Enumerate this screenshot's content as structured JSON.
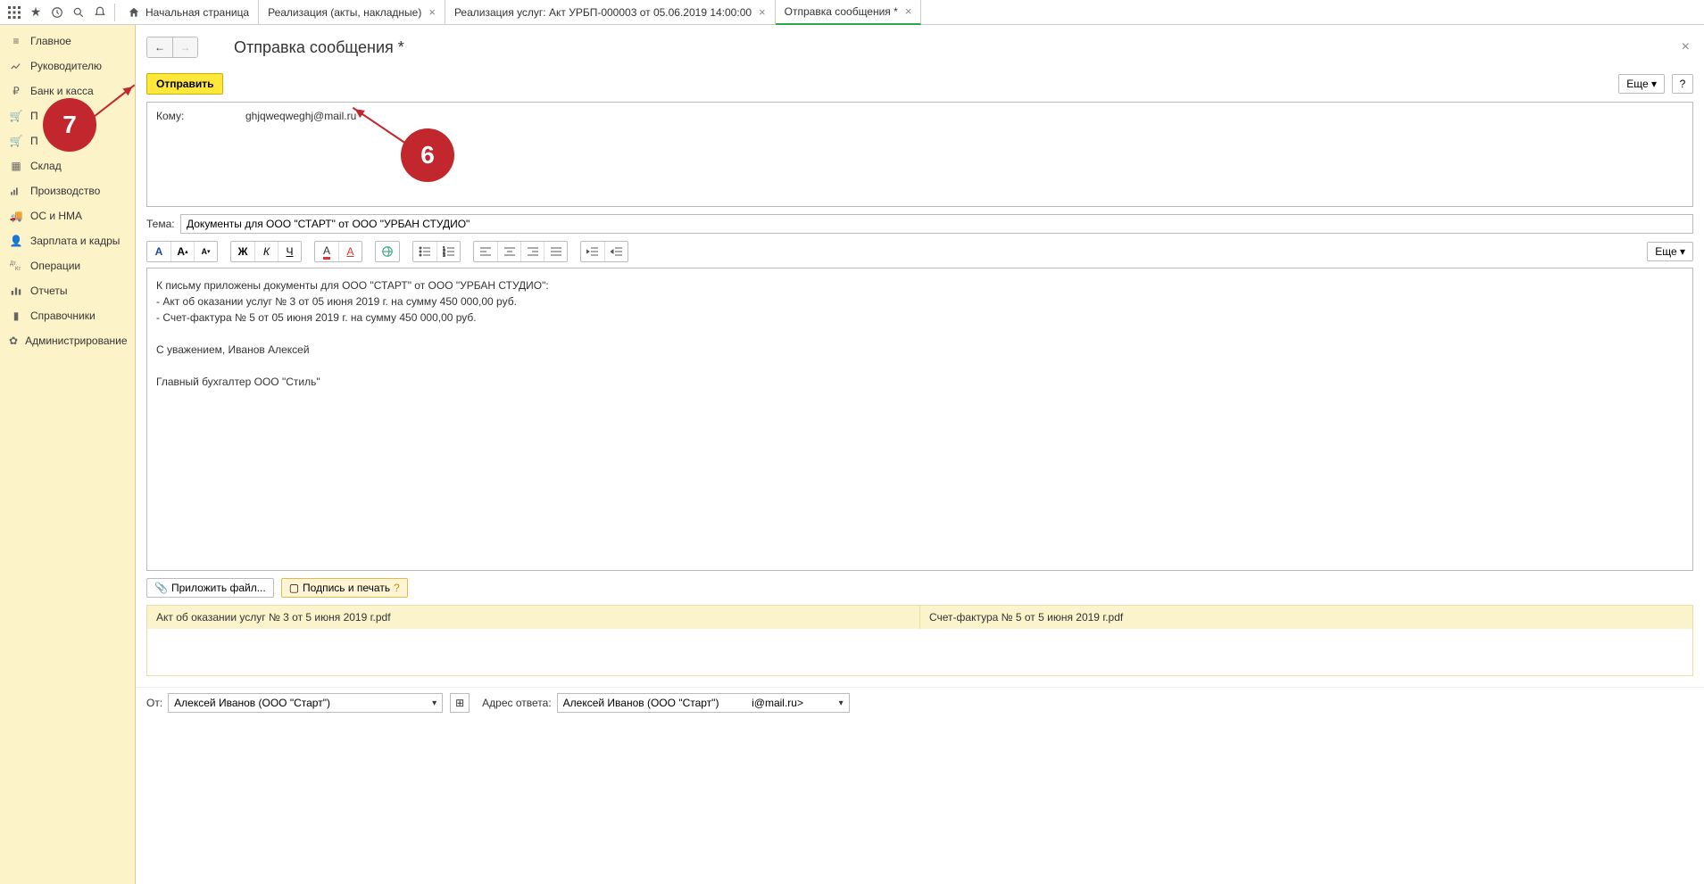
{
  "tabs": {
    "home": "Начальная страница",
    "t1": "Реализация (акты, накладные)",
    "t2": "Реализация услуг: Акт УРБП-000003 от 05.06.2019 14:00:00",
    "t3": "Отправка сообщения *"
  },
  "sidebar": {
    "items": [
      "Главное",
      "Руководителю",
      "Банк и касса",
      "П",
      "П",
      "Склад",
      "Производство",
      "ОС и НМА",
      "Зарплата и кадры",
      "Операции",
      "Отчеты",
      "Справочники",
      "Администрирование"
    ]
  },
  "page": {
    "title": "Отправка сообщения *",
    "send": "Отправить",
    "more": "Еще",
    "more2": "Еще",
    "help": "?",
    "to_label": "Кому:",
    "to_value": "ghjqweqweghj@mail.ru",
    "subject_label": "Тема:",
    "subject_value": "Документы для ООО \"СТАРТ\" от ООО \"УРБАН СТУДИО\"",
    "body_l1": "К письму приложены документы для ООО \"СТАРТ\" от ООО \"УРБАН СТУДИО\":",
    "body_l2": "- Акт об оказании услуг № 3 от 05 июня 2019 г. на сумму 450 000,00 руб.",
    "body_l3": "- Счет-фактура № 5 от 05 июня 2019 г. на сумму 450 000,00 руб.",
    "body_l4": "С уважением, Иванов Алексей",
    "body_l5": "Главный бухгалтер ООО \"Стиль\"",
    "attach_btn": "Приложить файл...",
    "sign_btn": "Подпись и печать",
    "attach1": "Акт об оказании услуг № 3 от 5 июня 2019 г.pdf",
    "attach2": "Счет-фактура № 5 от 5 июня 2019 г.pdf",
    "from_label": "От:",
    "from_value": "Алексей Иванов (ООО \"Старт\")",
    "reply_label": "Адрес ответа:",
    "reply_value": "Алексей Иванов (ООО \"Старт\")           і@mail.ru>"
  },
  "callouts": {
    "six": "6",
    "seven": "7"
  }
}
